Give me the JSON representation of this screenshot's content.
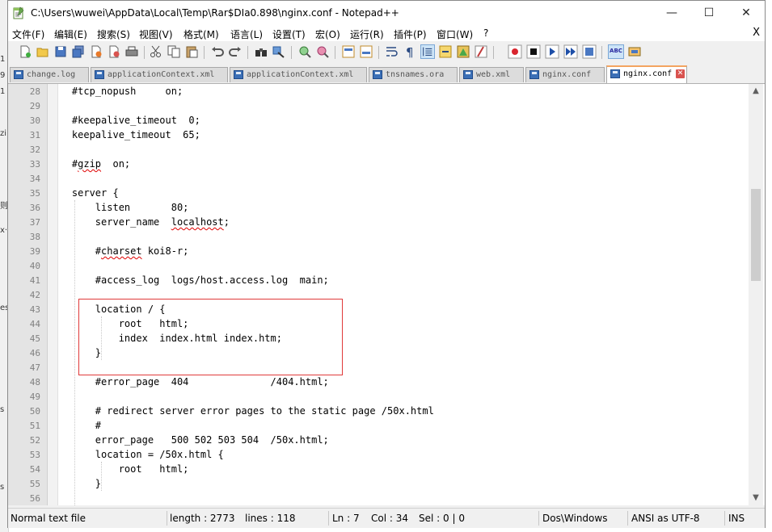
{
  "window": {
    "title": "C:\\Users\\wuwei\\AppData\\Local\\Temp\\Rar$DIa0.898\\nginx.conf - Notepad++",
    "minimize": "—",
    "maximize": "☐",
    "close": "✕"
  },
  "background_labels": [
    "1",
    "9",
    "1",
    "zi",
    "则",
    "x·",
    "es",
    "s",
    "s"
  ],
  "menu": {
    "items": [
      "文件(F)",
      "编辑(E)",
      "搜索(S)",
      "视图(V)",
      "格式(M)",
      "语言(L)",
      "设置(T)",
      "宏(O)",
      "运行(R)",
      "插件(P)",
      "窗口(W)",
      "?"
    ],
    "close_label": "X"
  },
  "toolbar": {
    "icons": [
      "new-icon",
      "open-icon",
      "save-icon",
      "save-all-icon",
      "close-icon",
      "close-all-icon",
      "print-icon",
      "cut-icon",
      "copy-icon",
      "paste-icon",
      "undo-icon",
      "redo-icon",
      "find-icon",
      "replace-icon",
      "zoom-in-icon",
      "zoom-out-icon",
      "sync-v-icon",
      "sync-h-icon",
      "word-wrap-icon",
      "all-chars-icon",
      "indent-guide-icon",
      "lang-icon",
      "doc-map-icon",
      "func-list-icon",
      "record-icon",
      "stop-icon",
      "play-icon",
      "play-multi-icon",
      "save-macro-icon",
      "spellcheck-icon",
      "extra-icon"
    ],
    "spellcheck_label": "ABC"
  },
  "tabs": [
    {
      "label": "change.log",
      "active": false
    },
    {
      "label": "applicationContext.xml",
      "active": false
    },
    {
      "label": "applicationContext.xml",
      "active": false
    },
    {
      "label": "tnsnames.ora",
      "active": false
    },
    {
      "label": "web.xml",
      "active": false
    },
    {
      "label": "nginx.conf",
      "active": false
    },
    {
      "label": "nginx.conf",
      "active": true
    }
  ],
  "editor": {
    "lines": [
      {
        "n": "28",
        "text": "    #tcp_nopush     on;"
      },
      {
        "n": "29",
        "text": ""
      },
      {
        "n": "30",
        "text": "    #keepalive_timeout  0;"
      },
      {
        "n": "31",
        "text": "    keepalive_timeout  65;"
      },
      {
        "n": "32",
        "text": ""
      },
      {
        "n": "33",
        "text": "    #gzip  on;"
      },
      {
        "n": "34",
        "text": ""
      },
      {
        "n": "35",
        "text": "    server {"
      },
      {
        "n": "36",
        "text": "        listen       80;"
      },
      {
        "n": "37",
        "text": "        server_name  localhost;"
      },
      {
        "n": "38",
        "text": ""
      },
      {
        "n": "39",
        "text": "        #charset koi8-r;"
      },
      {
        "n": "40",
        "text": ""
      },
      {
        "n": "41",
        "text": "        #access_log  logs/host.access.log  main;"
      },
      {
        "n": "42",
        "text": ""
      },
      {
        "n": "43",
        "text": "        location / {"
      },
      {
        "n": "44",
        "text": "            root   html;"
      },
      {
        "n": "45",
        "text": "            index  index.html index.htm;"
      },
      {
        "n": "46",
        "text": "        }"
      },
      {
        "n": "47",
        "text": ""
      },
      {
        "n": "48",
        "text": "        #error_page  404              /404.html;"
      },
      {
        "n": "49",
        "text": ""
      },
      {
        "n": "50",
        "text": "        # redirect server error pages to the static page /50x.html"
      },
      {
        "n": "51",
        "text": "        #"
      },
      {
        "n": "52",
        "text": "        error_page   500 502 503 504  /50x.html;"
      },
      {
        "n": "53",
        "text": "        location = /50x.html {"
      },
      {
        "n": "54",
        "text": "            root   html;"
      },
      {
        "n": "55",
        "text": "        }"
      },
      {
        "n": "56",
        "text": ""
      }
    ]
  },
  "scrollbar": {
    "up": "▲",
    "down": "▼"
  },
  "statusbar": {
    "type": "Normal text file",
    "length": "length : 2773",
    "lines": "lines : 118",
    "ln": "Ln : 7",
    "col": "Col : 34",
    "sel": "Sel : 0 | 0",
    "eol": "Dos\\Windows",
    "encoding": "ANSI as UTF-8",
    "mode": "INS"
  },
  "colors": {
    "highlight_box": "#e03a3a",
    "active_tab_accent": "#f4a460",
    "spell_underline": "#e00000"
  }
}
